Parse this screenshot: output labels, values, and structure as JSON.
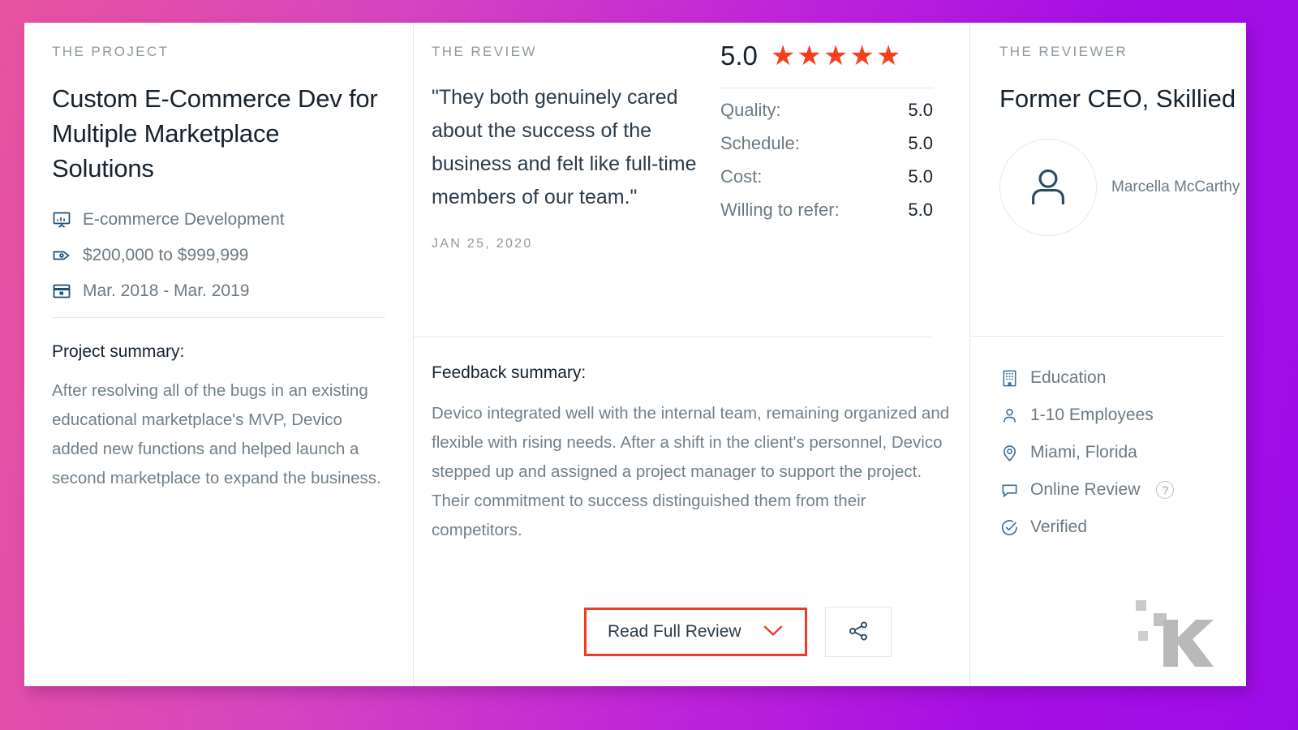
{
  "background": {
    "from": "#e8539f",
    "to": "#9d0ce8"
  },
  "accent": {
    "star": "#f4401f",
    "button_border": "#ee3c25",
    "icon_navy": "#1c4f76"
  },
  "project": {
    "eyebrow": "THE PROJECT",
    "title": "Custom E-Commerce Dev for Multiple Marketplace Solutions",
    "meta": [
      {
        "icon": "presentation-chart-icon",
        "label": "E-commerce Development"
      },
      {
        "icon": "price-tag-icon",
        "label": "$200,000 to $999,999"
      },
      {
        "icon": "calendar-icon",
        "label": "Mar. 2018 - Mar. 2019"
      }
    ],
    "summary_heading": "Project summary:",
    "summary_text": "After resolving all of the bugs in an existing educational marketplace's MVP, Devico added new functions and helped launch a second marketplace to expand the business."
  },
  "review": {
    "eyebrow": "THE REVIEW",
    "quote": "\"They both genuinely cared about the success of the business and felt like full-time members of our team.\"",
    "date": "JAN 25, 2020",
    "overall_score": "5.0",
    "stars": 5,
    "ratings": [
      {
        "label": "Quality:",
        "value": "5.0"
      },
      {
        "label": "Schedule:",
        "value": "5.0"
      },
      {
        "label": "Cost:",
        "value": "5.0"
      },
      {
        "label": "Willing to refer:",
        "value": "5.0"
      }
    ],
    "feedback_heading": "Feedback summary:",
    "feedback_text": "Devico integrated well with the internal team, remaining organized and flexible with rising needs. After a shift in the client's personnel, Devico stepped up and assigned a project manager to support the project. Their commitment to success distinguished them from their competitors.",
    "read_button": "Read Full Review",
    "read_button_icon": "chevron-down-icon",
    "share_button_icon": "share-icon"
  },
  "reviewer": {
    "eyebrow": "THE REVIEWER",
    "title": "Former CEO, Skillied",
    "avatar_icon": "user-avatar-icon",
    "name": "Marcella McCarthy",
    "meta": [
      {
        "icon": "building-icon",
        "label": "Education"
      },
      {
        "icon": "person-icon",
        "label": "1-10 Employees"
      },
      {
        "icon": "location-pin-icon",
        "label": "Miami, Florida"
      },
      {
        "icon": "speech-bubble-icon",
        "label": "Online Review",
        "help": "?"
      },
      {
        "icon": "check-circle-icon",
        "label": "Verified"
      }
    ],
    "watermark": "clutch-k-logo"
  }
}
